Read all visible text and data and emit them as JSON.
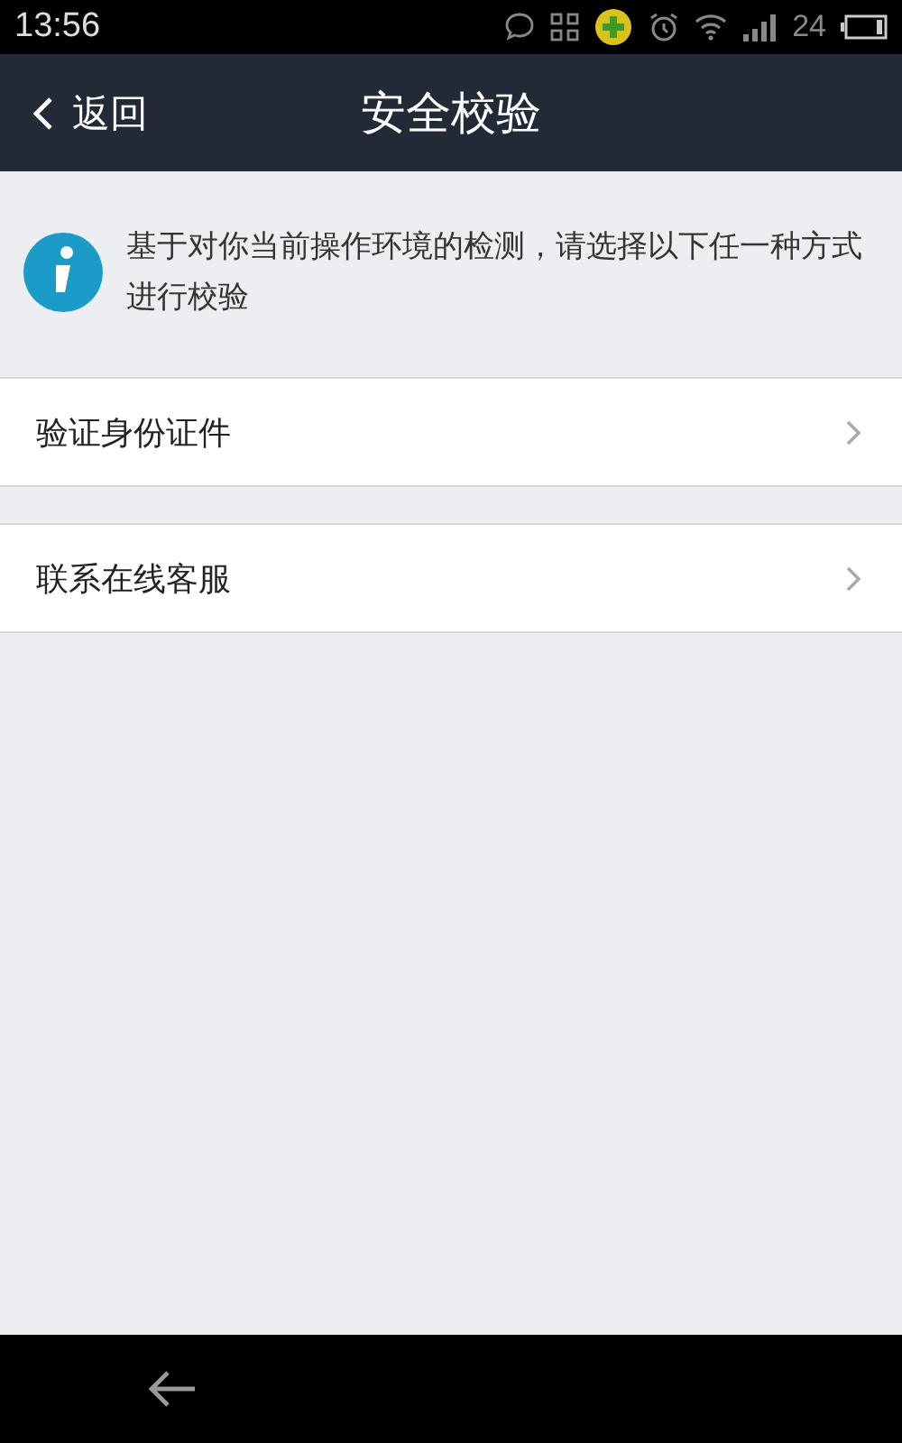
{
  "status_bar": {
    "time": "13:56",
    "battery": "24"
  },
  "nav_bar": {
    "back": "返回",
    "title": "安全校验"
  },
  "notice": "基于对你当前操作环境的检测，请选择以下任一种方式进行校验",
  "options": [
    {
      "label": "验证身份证件"
    },
    {
      "label": "联系在线客服"
    }
  ]
}
